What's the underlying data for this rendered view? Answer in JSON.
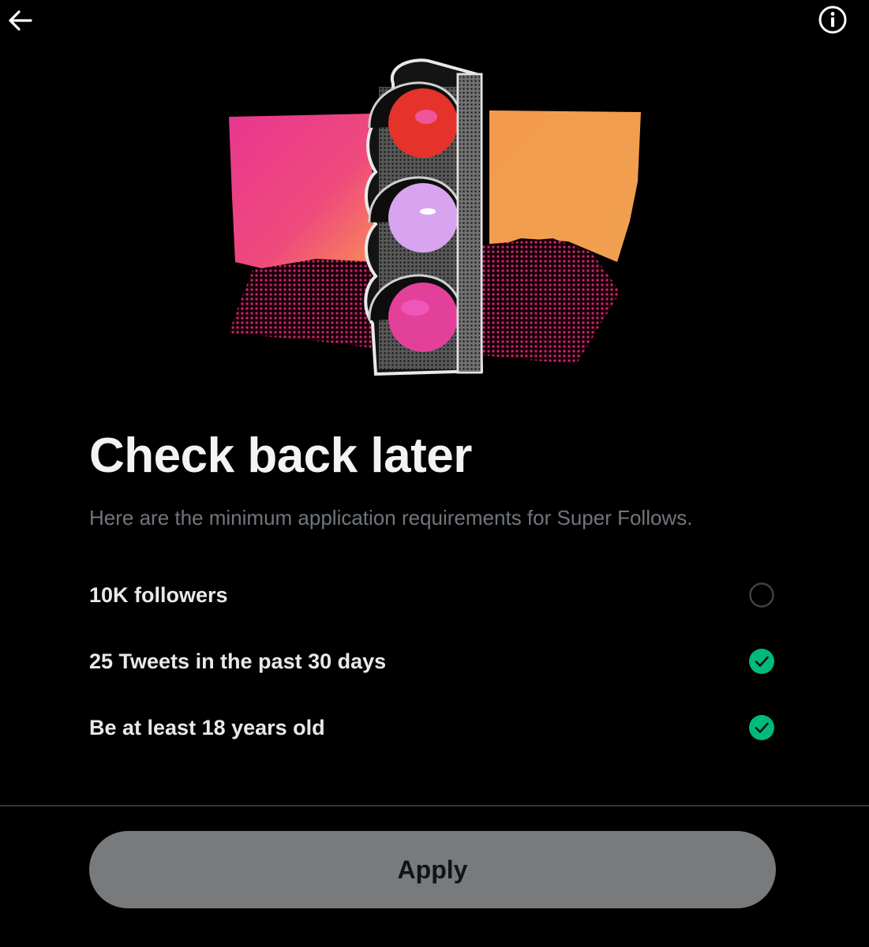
{
  "header": {
    "back_icon": "arrow-left-icon",
    "info_icon": "info-circle-icon"
  },
  "hero": {
    "icon": "traffic-light-illustration",
    "colors": {
      "pink": "#ec3f8f",
      "orange": "#f59a45",
      "red_light": "#e23a2e",
      "lilac_light": "#d9a6f0",
      "magenta_light": "#e43d95"
    }
  },
  "content": {
    "title": "Check back later",
    "subtitle": "Here are the minimum application requirements for Super Follows."
  },
  "requirements": [
    {
      "label": "10K followers",
      "met": false,
      "icon": "empty-circle-icon"
    },
    {
      "label": "25 Tweets in the past 30 days",
      "met": true,
      "icon": "check-circle-icon"
    },
    {
      "label": "Be at least 18 years old",
      "met": true,
      "icon": "check-circle-icon"
    }
  ],
  "footer": {
    "apply_label": "Apply"
  },
  "colors": {
    "background": "#000000",
    "check_green": "#00ba7c",
    "button_bg": "#787a7c",
    "muted_text": "#71767b"
  }
}
